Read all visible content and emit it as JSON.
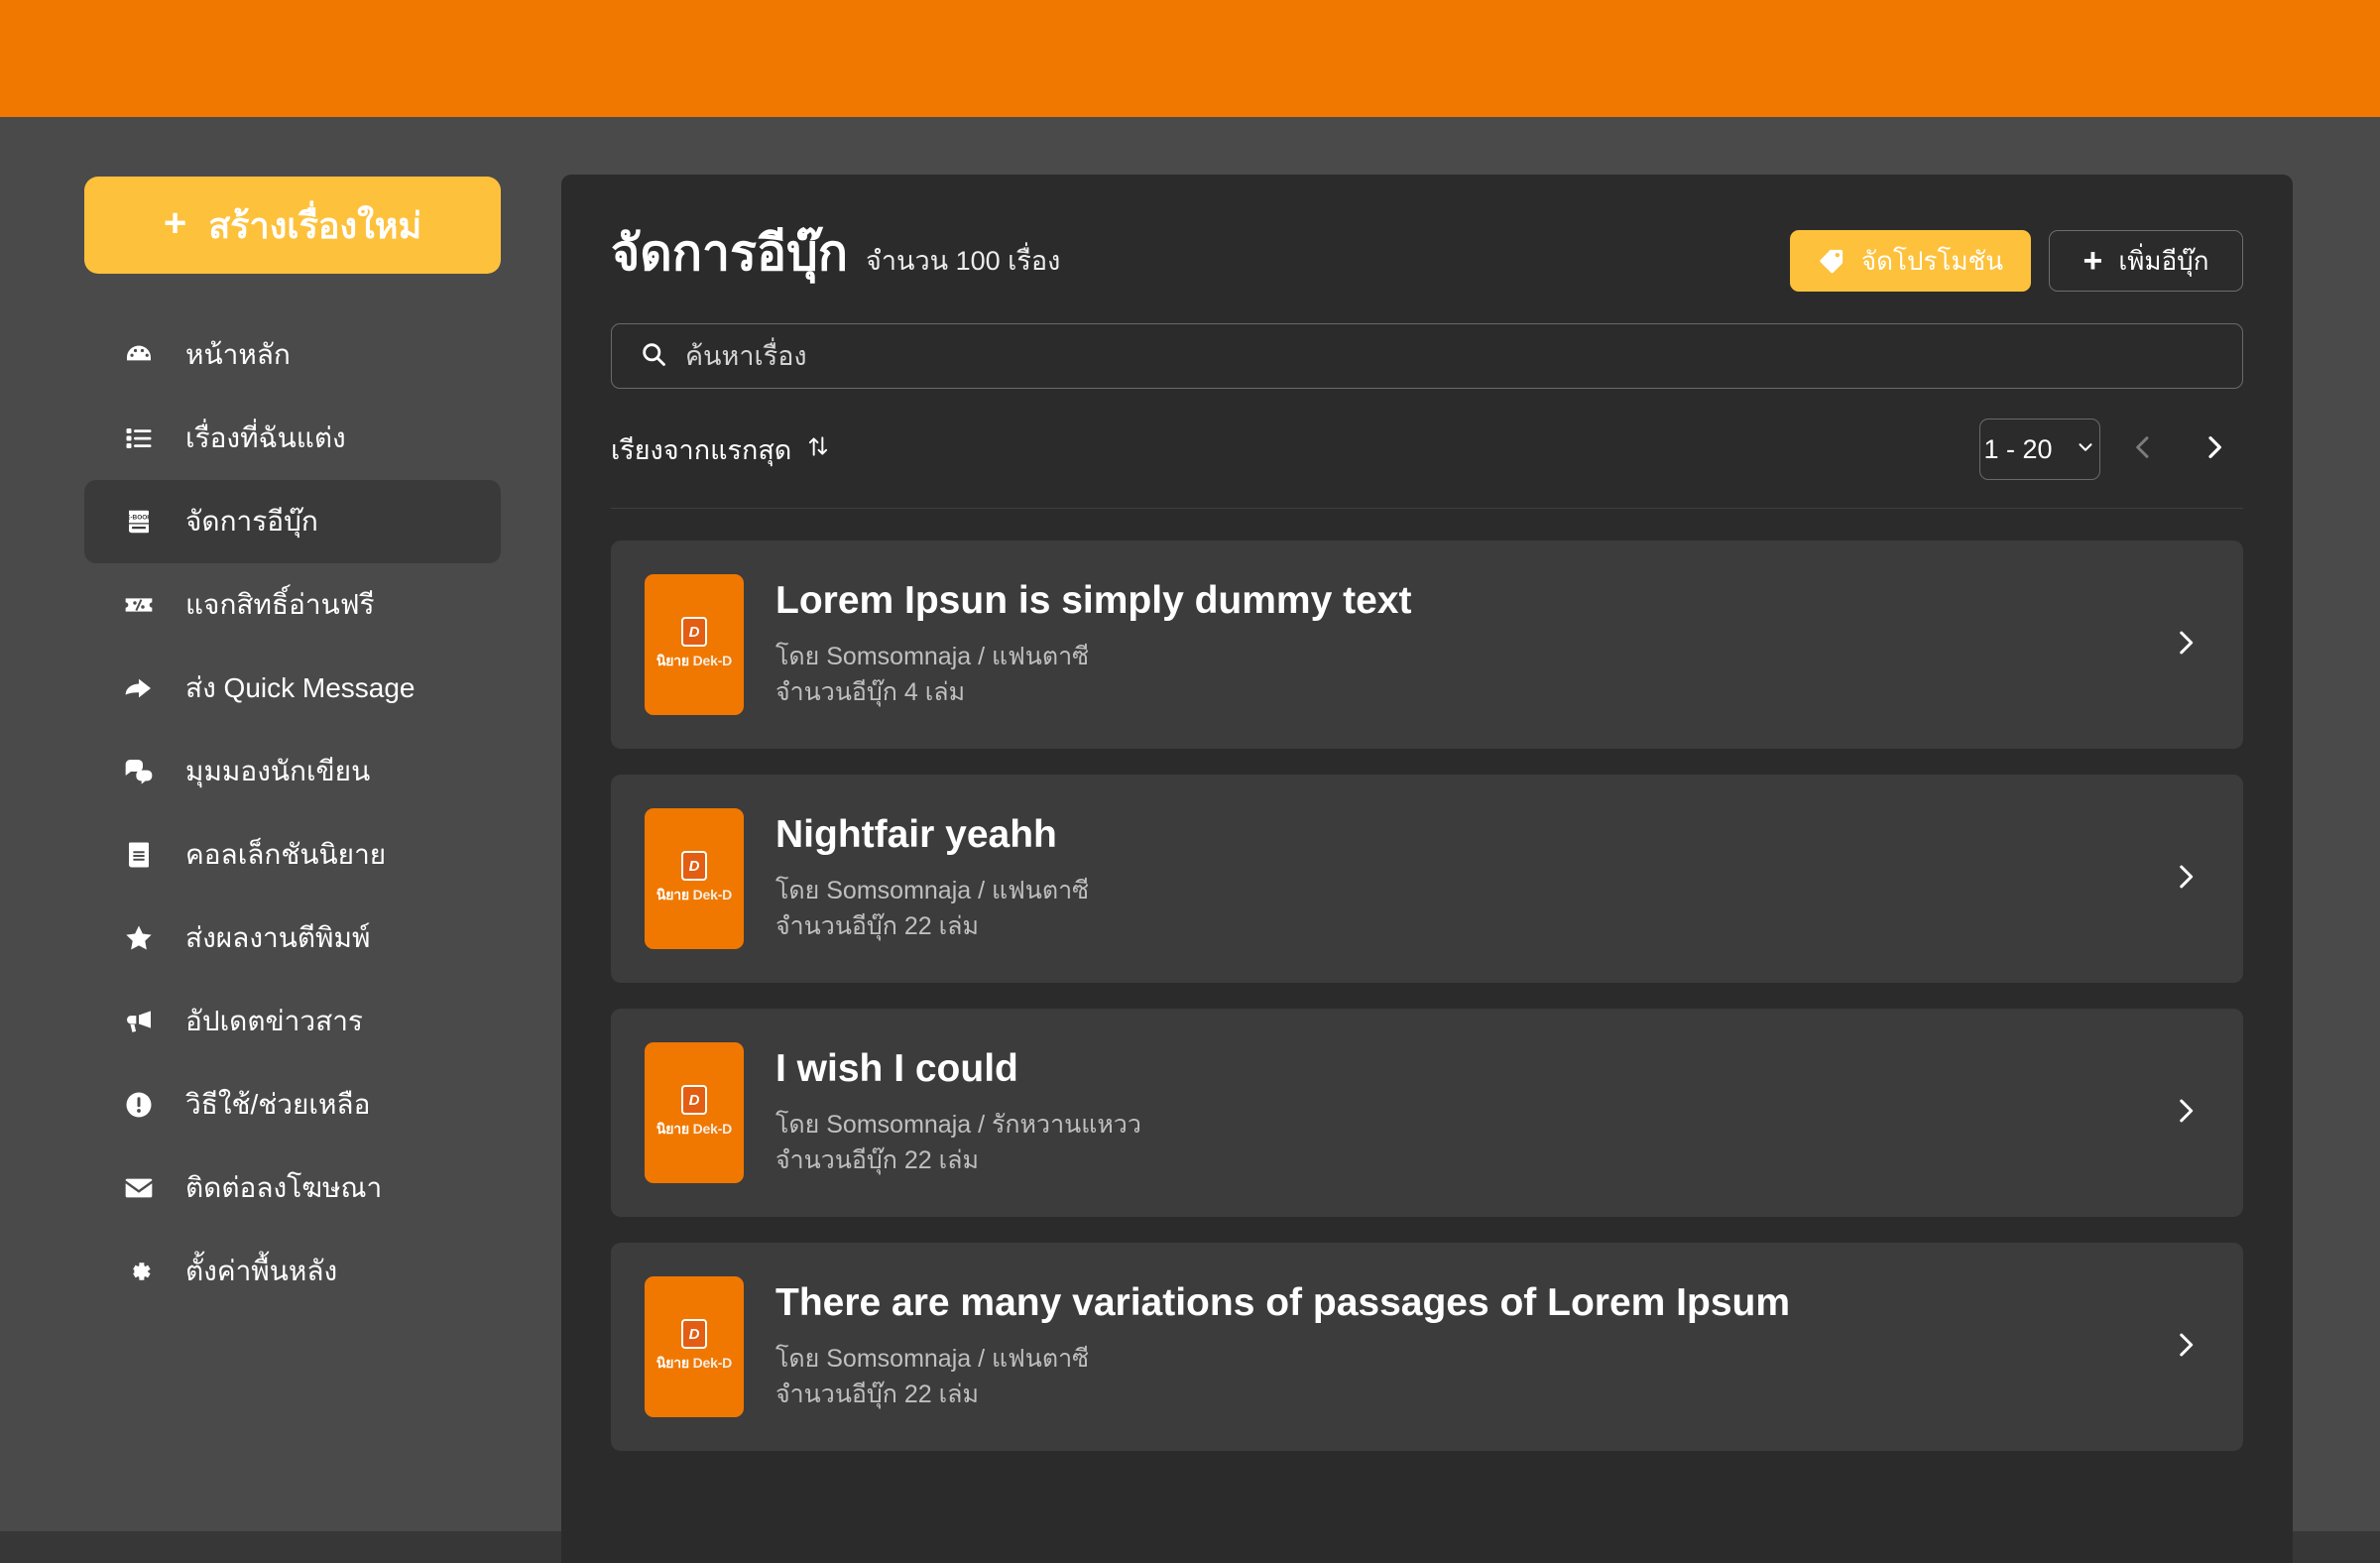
{
  "topbar": {
    "background": "#F07800"
  },
  "theme": {
    "orange": "#F07800",
    "yellow": "#FDC13C",
    "sidebar_bg": "#4A4A4A",
    "panel_bg": "#2B2B2B",
    "card_bg": "#3C3C3C"
  },
  "sidebar": {
    "create_button": {
      "label": "สร้างเรื่องใหม่",
      "plus": "+"
    },
    "items": [
      {
        "label": "หน้าหลัก",
        "icon": "dashboard-icon",
        "active": false
      },
      {
        "label": "เรื่องที่ฉันแต่ง",
        "icon": "list-icon",
        "active": false
      },
      {
        "label": "จัดการอีบุ๊ก",
        "icon": "ebook-icon",
        "active": true
      },
      {
        "label": "แจกสิทธิ์อ่านฟรี",
        "icon": "ticket-percent-icon",
        "active": false
      },
      {
        "label": "ส่ง Quick Message",
        "icon": "share-arrow-icon",
        "active": false
      },
      {
        "label": "มุมมองนักเขียน",
        "icon": "chat-bubbles-icon",
        "active": false
      },
      {
        "label": "คอลเล็กชันนิยาย",
        "icon": "book-icon",
        "active": false
      },
      {
        "label": "ส่งผลงานตีพิมพ์",
        "icon": "star-icon",
        "active": false
      },
      {
        "label": "อัปเดตข่าวสาร",
        "icon": "megaphone-icon",
        "active": false
      },
      {
        "label": "วิธีใช้/ช่วยเหลือ",
        "icon": "help-exclamation-icon",
        "active": false
      },
      {
        "label": "ติดต่อลงโฆษณา",
        "icon": "envelope-icon",
        "active": false
      },
      {
        "label": "ตั้งค่าพื้นหลัง",
        "icon": "gear-icon",
        "active": false
      }
    ]
  },
  "main": {
    "title": "จัดการอีบุ๊ก",
    "count_label": "จำนวน 100 เรื่อง",
    "actions": {
      "promo": {
        "label": "จัดโปรโมชัน",
        "icon": "tag-icon"
      },
      "add": {
        "label": "เพิ่มอีบุ๊ก",
        "icon": "plus-icon",
        "plus": "+"
      }
    },
    "search": {
      "placeholder": "ค้นหาเรื่อง",
      "value": "",
      "icon": "search-icon"
    },
    "sort": {
      "label": "เรียงจากแรกสุด",
      "icon": "sort-updown-icon"
    },
    "pagination": {
      "range_label": "1 - 20",
      "chevron": "chevron-down-icon",
      "prev_enabled": false,
      "next_enabled": true
    },
    "books": [
      {
        "title": "Lorem Ipsun is simply dummy text",
        "byline": "โดย Somsomnaja / แฟนตาซี",
        "volumes": "จำนวนอีบุ๊ก 4 เล่ม",
        "thumb_logo_thai": "นิยาย",
        "thumb_logo_brand": "Dek-D"
      },
      {
        "title": "Nightfair yeahh",
        "byline": "โดย Somsomnaja / แฟนตาซี",
        "volumes": "จำนวนอีบุ๊ก 22 เล่ม",
        "thumb_logo_thai": "นิยาย",
        "thumb_logo_brand": "Dek-D"
      },
      {
        "title": "I wish I could",
        "byline": "โดย Somsomnaja / รักหวานแหวว",
        "volumes": "จำนวนอีบุ๊ก 22 เล่ม",
        "thumb_logo_thai": "นิยาย",
        "thumb_logo_brand": "Dek-D"
      },
      {
        "title": "There are many variations of passages of Lorem Ipsum",
        "byline": "โดย Somsomnaja / แฟนตาซี",
        "volumes": "จำนวนอีบุ๊ก 22 เล่ม",
        "thumb_logo_thai": "นิยาย",
        "thumb_logo_brand": "Dek-D"
      }
    ]
  }
}
